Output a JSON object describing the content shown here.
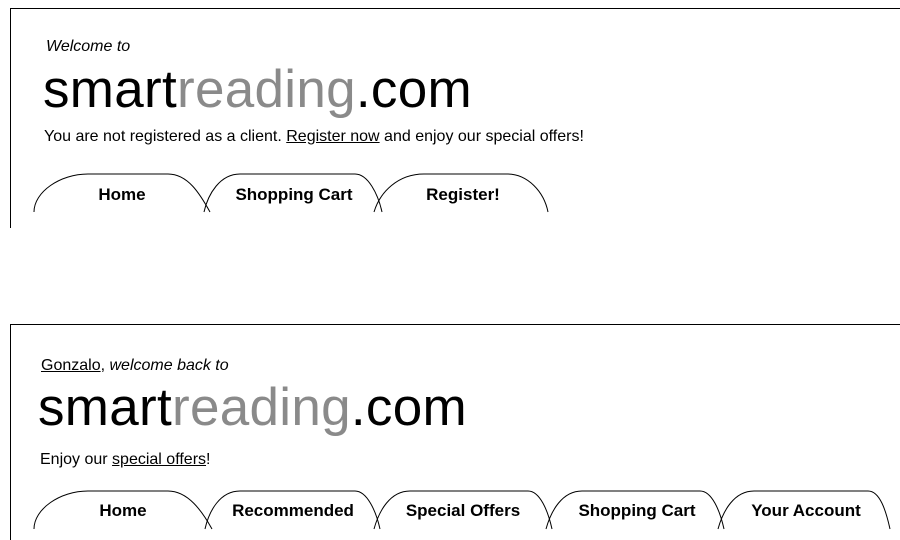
{
  "guest_header": {
    "welcome_text": "Welcome to",
    "logo": {
      "part1": "smart",
      "part2": "reading",
      "part3": ".com"
    },
    "notice_before": "You are not registered as a client. ",
    "notice_link": "Register now",
    "notice_after": " and enjoy our special offers!",
    "tabs": [
      "Home",
      "Shopping Cart",
      "Register!"
    ]
  },
  "member_header": {
    "user_name": "Gonzalo",
    "welcome_separator": ", ",
    "welcome_text": "welcome back to",
    "logo": {
      "part1": "smart",
      "part2": "reading",
      "part3": ".com"
    },
    "notice_before": "Enjoy our ",
    "notice_link": "special offers",
    "notice_after": "!",
    "tabs": [
      "Home",
      "Recommended",
      "Special Offers",
      "Shopping Cart",
      "Your Account"
    ]
  },
  "colors": {
    "logo_light": "#8a8a8a",
    "ink": "#000000",
    "background": "#ffffff"
  }
}
